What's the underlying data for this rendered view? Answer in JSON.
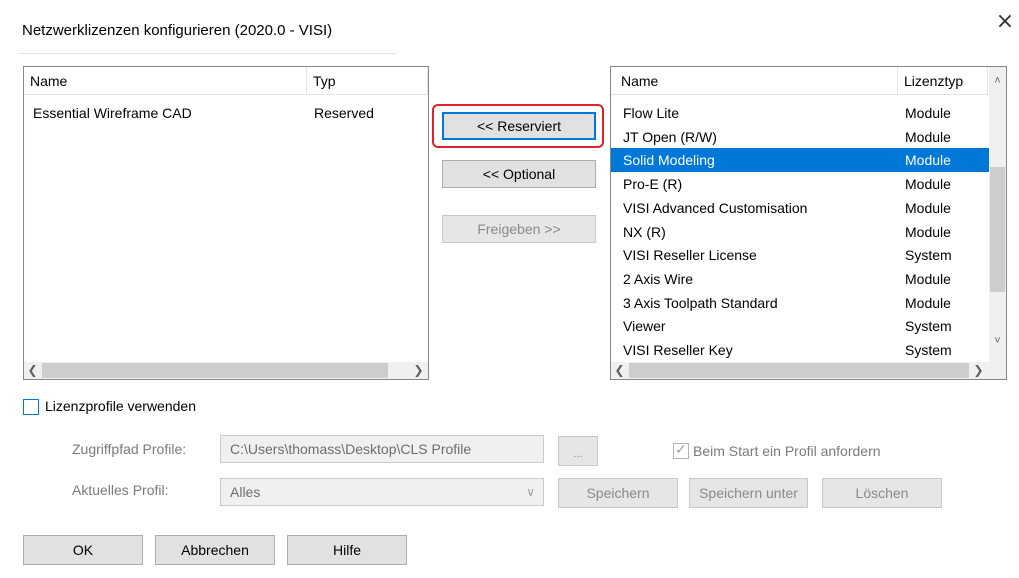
{
  "window": {
    "title": "Netzwerklizenzen konfigurieren (2020.0 - VISI)",
    "close_icon": "×"
  },
  "left_list": {
    "columns": [
      "Name",
      "Typ"
    ],
    "rows": [
      {
        "name": "Essential Wireframe CAD",
        "type": "Reserved"
      }
    ]
  },
  "buttons": {
    "reserved": "<< Reserviert",
    "optional": "<< Optional",
    "release": "Freigeben >>"
  },
  "right_list": {
    "columns": [
      "Name",
      "Lizenztyp"
    ],
    "rows": [
      {
        "name": "Flow Lite",
        "type": "Module"
      },
      {
        "name": "JT Open (R/W)",
        "type": "Module"
      },
      {
        "name": "Solid Modeling",
        "type": "Module",
        "selected": true
      },
      {
        "name": "Pro-E (R)",
        "type": "Module"
      },
      {
        "name": "VISI Advanced Customisation",
        "type": "Module"
      },
      {
        "name": "NX (R)",
        "type": "Module"
      },
      {
        "name": "VISI Reseller License",
        "type": "System"
      },
      {
        "name": "2 Axis Wire",
        "type": "Module"
      },
      {
        "name": "3 Axis Toolpath Standard",
        "type": "Module"
      },
      {
        "name": "Viewer",
        "type": "System"
      },
      {
        "name": "VISI Reseller Key",
        "type": "System"
      }
    ]
  },
  "profiles": {
    "use_label": "Lizenzprofile verwenden",
    "use_checked": false,
    "path_label": "Zugriffpfad Profile:",
    "path_value": "C:\\Users\\thomass\\Desktop\\CLS Profile",
    "browse_label": "...",
    "request_label": "Beim Start ein Profil anfordern",
    "request_checked": true,
    "current_label": "Aktuelles Profil:",
    "current_value": "Alles",
    "save": "Speichern",
    "save_as": "Speichern unter",
    "delete": "Löschen"
  },
  "footer": {
    "ok": "OK",
    "cancel": "Abbrechen",
    "help": "Hilfe"
  },
  "colors": {
    "selection": "#0078d7",
    "highlight_ring": "#e0202a"
  }
}
